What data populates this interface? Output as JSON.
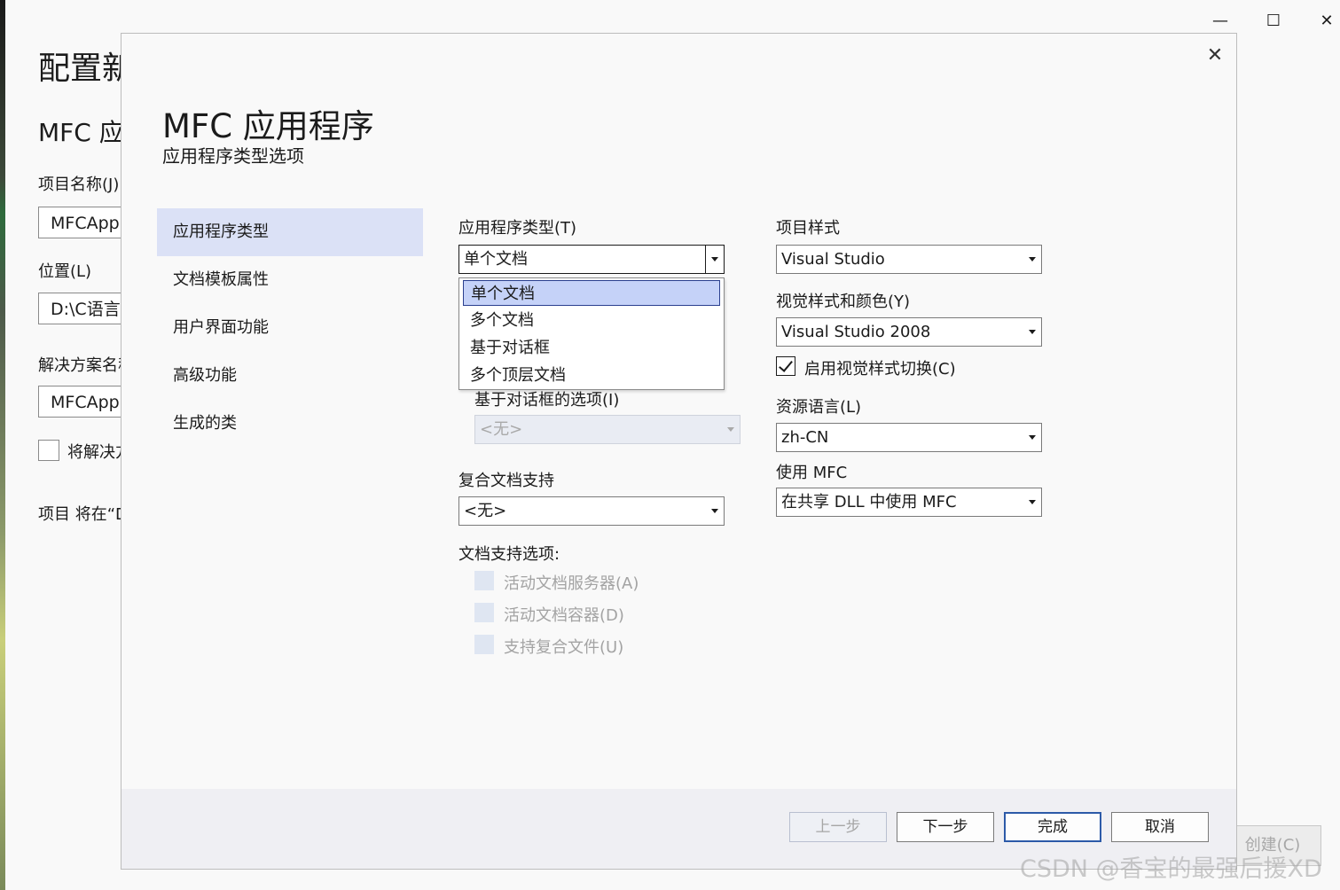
{
  "background_window": {
    "title_partial": "配置新",
    "subtitle_partial": "MFC 应",
    "project_name_label": "项目名称(J)",
    "project_name_value": "MFCApp",
    "location_label": "位置(L)",
    "location_value": "D:\\C语言",
    "solution_name_label": "解决方案名称",
    "solution_name_value": "MFCApp",
    "place_solution_checkbox_label": "将解决方",
    "project_path_note": "项目 将在“D",
    "create_button": "创建(C)",
    "window_controls": {
      "minimize": "—",
      "maximize": "☐",
      "close": "✕"
    }
  },
  "dialog": {
    "close": "✕",
    "title": "MFC 应用程序",
    "subtitle": "应用程序类型选项",
    "nav": [
      {
        "label": "应用程序类型",
        "active": true
      },
      {
        "label": "文档模板属性",
        "active": false
      },
      {
        "label": "用户界面功能",
        "active": false
      },
      {
        "label": "高级功能",
        "active": false
      },
      {
        "label": "生成的类",
        "active": false
      }
    ],
    "app_type": {
      "label": "应用程序类型(T)",
      "value": "单个文档",
      "options": [
        "单个文档",
        "多个文档",
        "基于对话框",
        "多个顶层文档"
      ],
      "selected_index": 0
    },
    "dialog_options": {
      "label": "基于对话框的选项(I)",
      "value": "<无>",
      "disabled": true
    },
    "compound_doc": {
      "label": "复合文档支持",
      "value": "<无>"
    },
    "doc_support": {
      "label": "文档支持选项:",
      "options": [
        {
          "label": "活动文档服务器(A)",
          "checked": false,
          "disabled": true
        },
        {
          "label": "活动文档容器(D)",
          "checked": false,
          "disabled": true
        },
        {
          "label": "支持复合文件(U)",
          "checked": false,
          "disabled": true
        }
      ]
    },
    "project_style": {
      "label": "项目样式",
      "value": "Visual Studio"
    },
    "visual_style": {
      "label": "视觉样式和颜色(Y)",
      "value": "Visual Studio 2008"
    },
    "enable_visual_switch": {
      "label": "启用视觉样式切换(C)",
      "checked": true
    },
    "resource_language": {
      "label": "资源语言(L)",
      "value": "zh-CN"
    },
    "use_mfc": {
      "label": "使用 MFC",
      "value": "在共享 DLL 中使用 MFC"
    },
    "buttons": {
      "back": "上一步",
      "next": "下一步",
      "finish": "完成",
      "cancel": "取消"
    }
  },
  "watermark": "CSDN @香宝的最强后援XD",
  "colors": {
    "nav_active_bg": "#dbe1f6",
    "dropdown_selected_bg": "#c5d2f8",
    "primary_button_border": "#2c5aa8",
    "footer_bg": "#efeff3"
  }
}
